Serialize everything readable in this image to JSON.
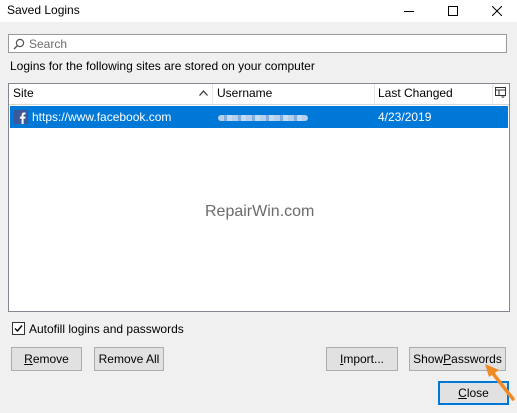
{
  "window": {
    "title": "Saved Logins"
  },
  "search": {
    "placeholder": "Search",
    "value": ""
  },
  "description": "Logins for the following sites are stored on your computer",
  "table": {
    "columns": [
      "Site",
      "Username",
      "Last Changed"
    ],
    "rows": [
      {
        "site": "https://www.facebook.com",
        "username": "",
        "last_changed": "4/23/2019",
        "selected": true
      }
    ]
  },
  "watermark": "RepairWin.com",
  "autofill": {
    "label": "Autofill logins and passwords",
    "checked": true
  },
  "buttons": {
    "remove": {
      "accel": "R",
      "rest": "emove"
    },
    "remove_all": "Remove All",
    "import": {
      "accel": "I",
      "rest": "mport..."
    },
    "show_passwords": {
      "pre": "Show ",
      "accel": "P",
      "rest": "asswords"
    },
    "close": {
      "accel": "C",
      "rest": "lose"
    }
  },
  "colors": {
    "selection": "#0078d7",
    "arrow": "#f08a24",
    "facebook": "#3b5998"
  },
  "icons": [
    "search-icon",
    "sort-ascending-icon",
    "column-picker-icon",
    "facebook-icon",
    "checkmark-icon",
    "arrow-annotation-icon",
    "minimize-icon",
    "maximize-icon",
    "close-icon"
  ]
}
